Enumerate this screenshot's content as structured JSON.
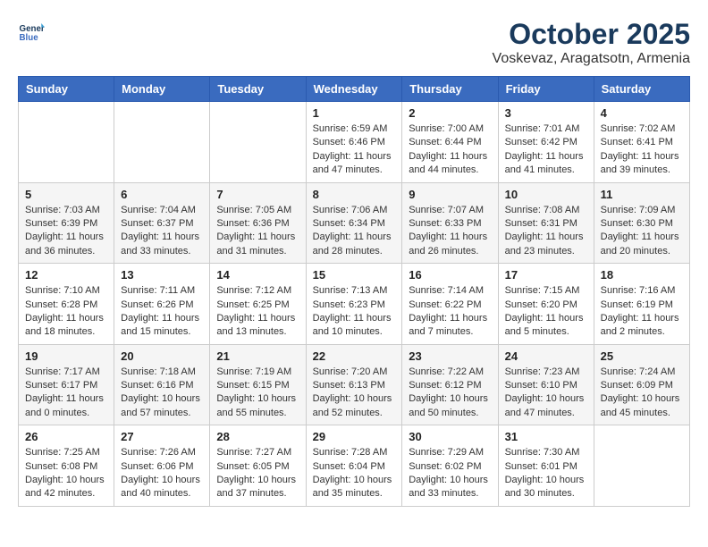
{
  "logo": {
    "line1": "General",
    "line2": "Blue"
  },
  "title": "October 2025",
  "location": "Voskevaz, Aragatsotn, Armenia",
  "weekdays": [
    "Sunday",
    "Monday",
    "Tuesday",
    "Wednesday",
    "Thursday",
    "Friday",
    "Saturday"
  ],
  "weeks": [
    [
      {
        "day": "",
        "info": ""
      },
      {
        "day": "",
        "info": ""
      },
      {
        "day": "",
        "info": ""
      },
      {
        "day": "1",
        "info": "Sunrise: 6:59 AM\nSunset: 6:46 PM\nDaylight: 11 hours and 47 minutes."
      },
      {
        "day": "2",
        "info": "Sunrise: 7:00 AM\nSunset: 6:44 PM\nDaylight: 11 hours and 44 minutes."
      },
      {
        "day": "3",
        "info": "Sunrise: 7:01 AM\nSunset: 6:42 PM\nDaylight: 11 hours and 41 minutes."
      },
      {
        "day": "4",
        "info": "Sunrise: 7:02 AM\nSunset: 6:41 PM\nDaylight: 11 hours and 39 minutes."
      }
    ],
    [
      {
        "day": "5",
        "info": "Sunrise: 7:03 AM\nSunset: 6:39 PM\nDaylight: 11 hours and 36 minutes."
      },
      {
        "day": "6",
        "info": "Sunrise: 7:04 AM\nSunset: 6:37 PM\nDaylight: 11 hours and 33 minutes."
      },
      {
        "day": "7",
        "info": "Sunrise: 7:05 AM\nSunset: 6:36 PM\nDaylight: 11 hours and 31 minutes."
      },
      {
        "day": "8",
        "info": "Sunrise: 7:06 AM\nSunset: 6:34 PM\nDaylight: 11 hours and 28 minutes."
      },
      {
        "day": "9",
        "info": "Sunrise: 7:07 AM\nSunset: 6:33 PM\nDaylight: 11 hours and 26 minutes."
      },
      {
        "day": "10",
        "info": "Sunrise: 7:08 AM\nSunset: 6:31 PM\nDaylight: 11 hours and 23 minutes."
      },
      {
        "day": "11",
        "info": "Sunrise: 7:09 AM\nSunset: 6:30 PM\nDaylight: 11 hours and 20 minutes."
      }
    ],
    [
      {
        "day": "12",
        "info": "Sunrise: 7:10 AM\nSunset: 6:28 PM\nDaylight: 11 hours and 18 minutes."
      },
      {
        "day": "13",
        "info": "Sunrise: 7:11 AM\nSunset: 6:26 PM\nDaylight: 11 hours and 15 minutes."
      },
      {
        "day": "14",
        "info": "Sunrise: 7:12 AM\nSunset: 6:25 PM\nDaylight: 11 hours and 13 minutes."
      },
      {
        "day": "15",
        "info": "Sunrise: 7:13 AM\nSunset: 6:23 PM\nDaylight: 11 hours and 10 minutes."
      },
      {
        "day": "16",
        "info": "Sunrise: 7:14 AM\nSunset: 6:22 PM\nDaylight: 11 hours and 7 minutes."
      },
      {
        "day": "17",
        "info": "Sunrise: 7:15 AM\nSunset: 6:20 PM\nDaylight: 11 hours and 5 minutes."
      },
      {
        "day": "18",
        "info": "Sunrise: 7:16 AM\nSunset: 6:19 PM\nDaylight: 11 hours and 2 minutes."
      }
    ],
    [
      {
        "day": "19",
        "info": "Sunrise: 7:17 AM\nSunset: 6:17 PM\nDaylight: 11 hours and 0 minutes."
      },
      {
        "day": "20",
        "info": "Sunrise: 7:18 AM\nSunset: 6:16 PM\nDaylight: 10 hours and 57 minutes."
      },
      {
        "day": "21",
        "info": "Sunrise: 7:19 AM\nSunset: 6:15 PM\nDaylight: 10 hours and 55 minutes."
      },
      {
        "day": "22",
        "info": "Sunrise: 7:20 AM\nSunset: 6:13 PM\nDaylight: 10 hours and 52 minutes."
      },
      {
        "day": "23",
        "info": "Sunrise: 7:22 AM\nSunset: 6:12 PM\nDaylight: 10 hours and 50 minutes."
      },
      {
        "day": "24",
        "info": "Sunrise: 7:23 AM\nSunset: 6:10 PM\nDaylight: 10 hours and 47 minutes."
      },
      {
        "day": "25",
        "info": "Sunrise: 7:24 AM\nSunset: 6:09 PM\nDaylight: 10 hours and 45 minutes."
      }
    ],
    [
      {
        "day": "26",
        "info": "Sunrise: 7:25 AM\nSunset: 6:08 PM\nDaylight: 10 hours and 42 minutes."
      },
      {
        "day": "27",
        "info": "Sunrise: 7:26 AM\nSunset: 6:06 PM\nDaylight: 10 hours and 40 minutes."
      },
      {
        "day": "28",
        "info": "Sunrise: 7:27 AM\nSunset: 6:05 PM\nDaylight: 10 hours and 37 minutes."
      },
      {
        "day": "29",
        "info": "Sunrise: 7:28 AM\nSunset: 6:04 PM\nDaylight: 10 hours and 35 minutes."
      },
      {
        "day": "30",
        "info": "Sunrise: 7:29 AM\nSunset: 6:02 PM\nDaylight: 10 hours and 33 minutes."
      },
      {
        "day": "31",
        "info": "Sunrise: 7:30 AM\nSunset: 6:01 PM\nDaylight: 10 hours and 30 minutes."
      },
      {
        "day": "",
        "info": ""
      }
    ]
  ]
}
